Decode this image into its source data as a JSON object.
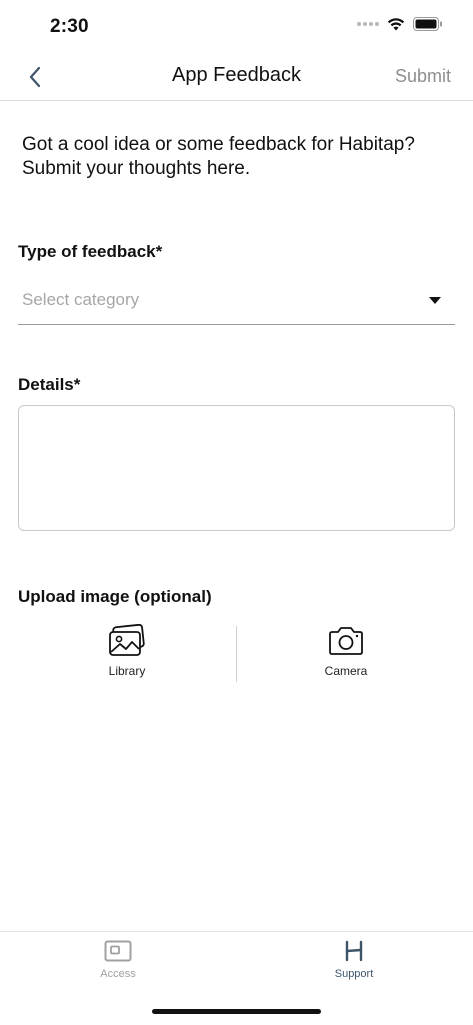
{
  "status_bar": {
    "time": "2:30",
    "signal_icon": "signal-dots-icon",
    "wifi_icon": "wifi-icon",
    "battery_icon": "battery-icon"
  },
  "nav": {
    "title": "App Feedback",
    "back_icon": "chevron-left-icon",
    "submit_label": "Submit",
    "accent_color": "#3d5468"
  },
  "intro": {
    "text": "Got a cool idea or some feedback for Habitap? Submit your thoughts here."
  },
  "form": {
    "type_label": "Type of feedback*",
    "category_placeholder": "Select category",
    "details_label": "Details*",
    "details_value": "",
    "upload_label": "Upload image (optional)",
    "upload_options": [
      {
        "label": "Library",
        "icon": "photo-library-icon"
      },
      {
        "label": "Camera",
        "icon": "camera-icon"
      }
    ]
  },
  "tabs": [
    {
      "label": "Access",
      "icon": "access-card-icon",
      "active": false,
      "color": "#a0a0a0"
    },
    {
      "label": "Support",
      "icon": "habitap-h-icon",
      "active": true,
      "color": "#3d5468"
    }
  ]
}
